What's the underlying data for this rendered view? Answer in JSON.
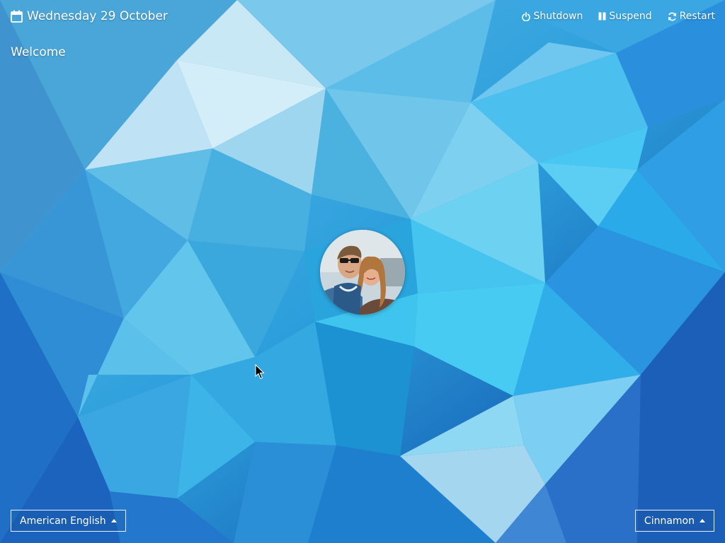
{
  "header": {
    "date": "Wednesday 29 October",
    "date_icon": "calendar-icon"
  },
  "greeting": "Welcome",
  "power_actions": [
    {
      "label": "Shutdown",
      "icon": "power-icon"
    },
    {
      "label": "Suspend",
      "icon": "pause-icon"
    },
    {
      "label": "Restart",
      "icon": "refresh-icon"
    }
  ],
  "user": {
    "avatar": "user-avatar-photo"
  },
  "language_selector": {
    "selected": "American English"
  },
  "session_selector": {
    "selected": "Cinnamon"
  },
  "colors": {
    "wallpaper_light": "#bfe6f8",
    "wallpaper_mid": "#3fb4e6",
    "wallpaper_dark": "#0d4fb0",
    "text": "#ffffff"
  }
}
